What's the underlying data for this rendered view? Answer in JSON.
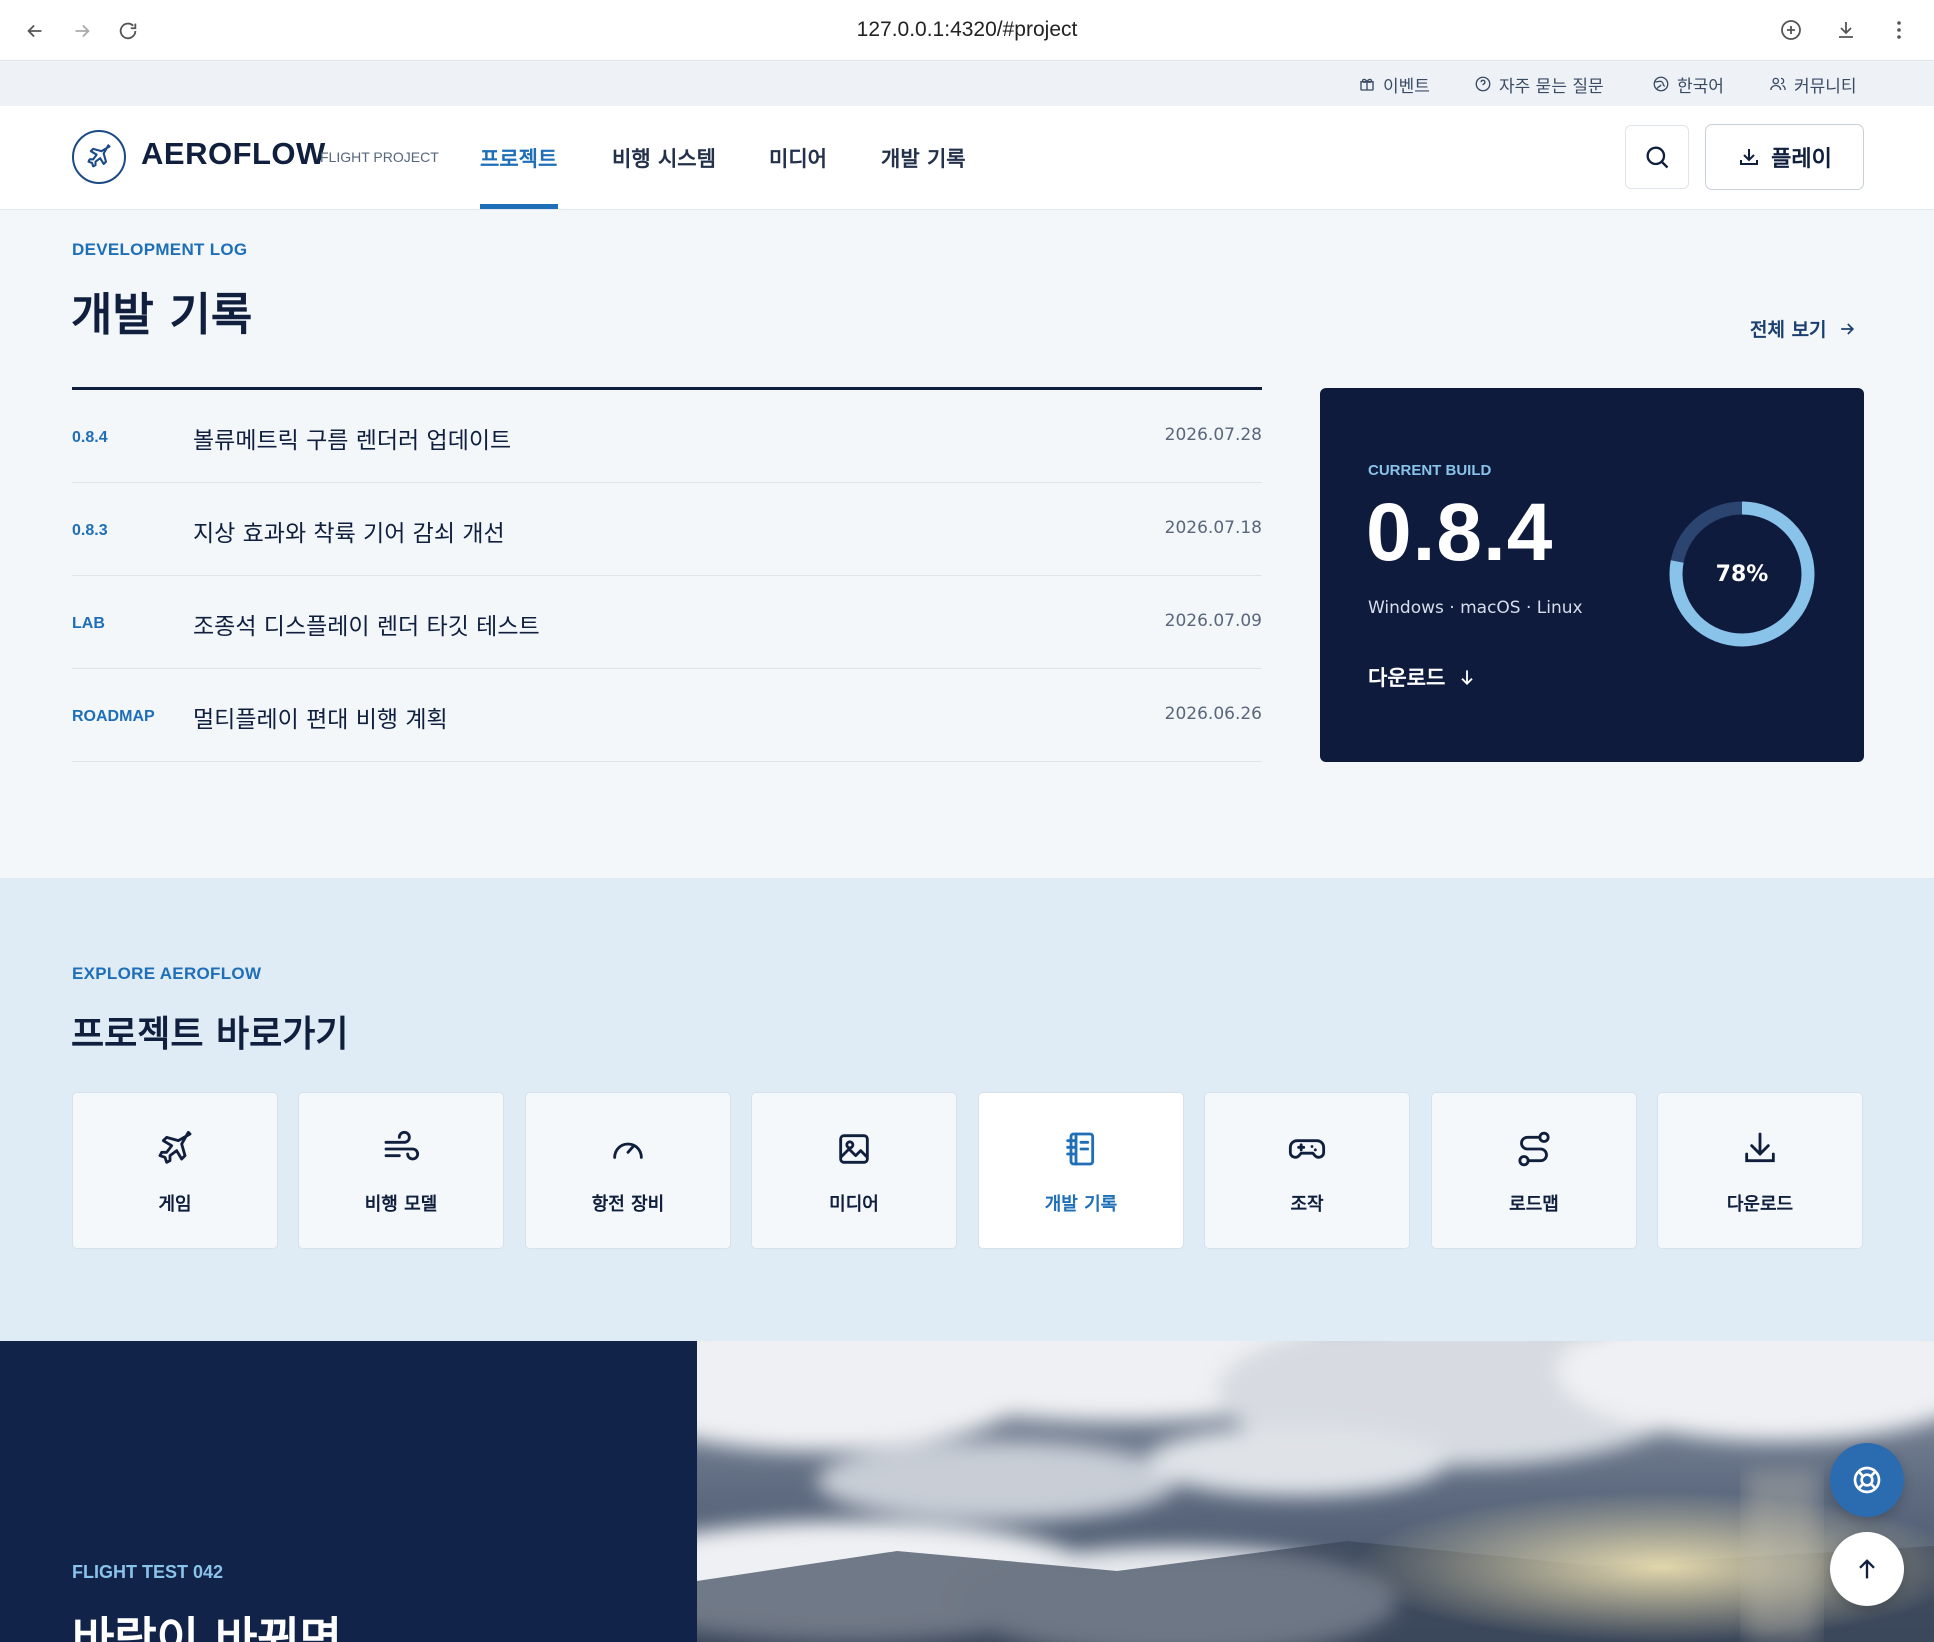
{
  "browser": {
    "url": "127.0.0.1:4320/#project"
  },
  "utility_nav": [
    {
      "label": "이벤트",
      "icon": "gift-icon"
    },
    {
      "label": "자주 묻는 질문",
      "icon": "help-circle-icon"
    },
    {
      "label": "한국어",
      "icon": "globe-icon"
    },
    {
      "label": "커뮤니티",
      "icon": "users-icon"
    }
  ],
  "header": {
    "brand": "AEROFLOW",
    "brand_sub": "FLIGHT PROJECT",
    "nav": [
      {
        "label": "프로젝트",
        "active": true
      },
      {
        "label": "비행 시스템",
        "active": false
      },
      {
        "label": "미디어",
        "active": false
      },
      {
        "label": "개발 기록",
        "active": false
      }
    ],
    "play_label": "플레이"
  },
  "devlog": {
    "eyebrow": "DEVELOPMENT LOG",
    "title": "개발 기록",
    "view_all": "전체 보기",
    "entries": [
      {
        "tag": "0.8.4",
        "title": "볼류메트릭 구름 렌더러 업데이트",
        "date": "2026.07.28"
      },
      {
        "tag": "0.8.3",
        "title": "지상 효과와 착륙 기어 감쇠 개선",
        "date": "2026.07.18"
      },
      {
        "tag": "LAB",
        "title": "조종석 디스플레이 렌더 타깃 테스트",
        "date": "2026.07.09"
      },
      {
        "tag": "ROADMAP",
        "title": "멀티플레이 편대 비행 계획",
        "date": "2026.06.26"
      }
    ]
  },
  "build": {
    "eyebrow": "CURRENT BUILD",
    "version": "0.8.4",
    "platforms": "Windows · macOS · Linux",
    "download": "다운로드",
    "progress_label": "78%",
    "progress_fraction": 0.78
  },
  "explore": {
    "eyebrow": "EXPLORE AEROFLOW",
    "title": "프로젝트 바로가기",
    "tiles": [
      {
        "label": "게임",
        "icon": "plane-icon",
        "active": false
      },
      {
        "label": "비행 모델",
        "icon": "wind-icon",
        "active": false
      },
      {
        "label": "항전 장비",
        "icon": "gauge-icon",
        "active": false
      },
      {
        "label": "미디어",
        "icon": "image-icon",
        "active": false
      },
      {
        "label": "개발 기록",
        "icon": "notebook-icon",
        "active": true
      },
      {
        "label": "조작",
        "icon": "gamepad-icon",
        "active": false
      },
      {
        "label": "로드맵",
        "icon": "route-icon",
        "active": false
      },
      {
        "label": "다운로드",
        "icon": "download-icon",
        "active": false
      }
    ]
  },
  "hero": {
    "eyebrow": "FLIGHT TEST 042",
    "title": "바람이 바뀌면"
  },
  "colors": {
    "accent": "#1e6fb8",
    "navy": "#0f1b3d",
    "ring": "#8ac3ea"
  }
}
